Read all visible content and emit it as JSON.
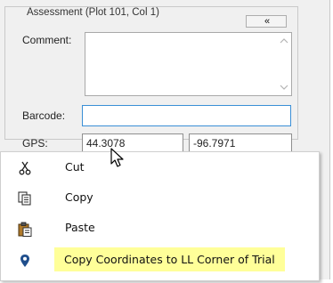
{
  "panel": {
    "group_title": "Assessment (Plot 101, Col  1)",
    "collapse_glyph": "«",
    "comment_label": "Comment:",
    "comment_value": "",
    "barcode_label": "Barcode:",
    "barcode_value": "",
    "gps_label": "GPS:",
    "gps_lat": "44.3078",
    "gps_lon": "-96.7971"
  },
  "context_menu": {
    "items": [
      {
        "label": "Cut",
        "icon": "scissors-icon"
      },
      {
        "label": "Copy",
        "icon": "copy-icon"
      },
      {
        "label": "Paste",
        "icon": "paste-icon"
      },
      {
        "label": "Copy Coordinates to LL Corner of Trial",
        "icon": "map-pin-icon"
      }
    ]
  },
  "colors": {
    "highlight": "#ffff99",
    "focus_border": "#3a8fd6",
    "pin": "#1f4e8c"
  }
}
